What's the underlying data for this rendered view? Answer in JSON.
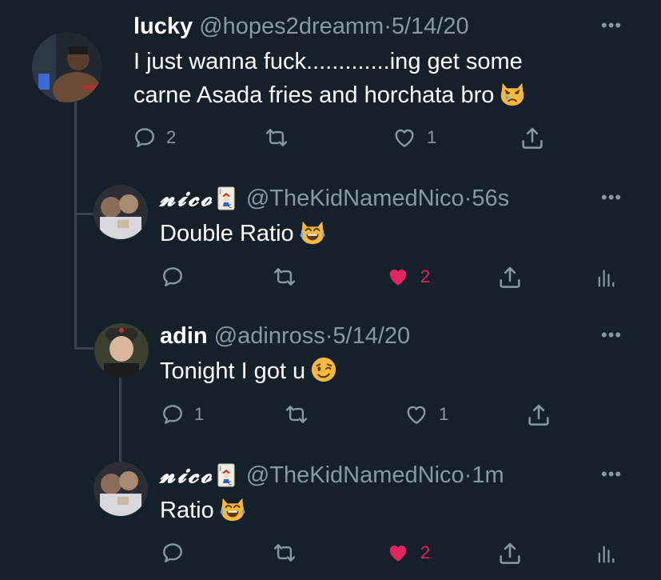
{
  "colors": {
    "background": "#15202b",
    "text": "#ffffff",
    "secondary": "#8899a6",
    "like": "#e0245e",
    "thread_line": "#38444d"
  },
  "tweets": [
    {
      "name": "lucky",
      "handle": "@hopes2dreamm",
      "separator": "·",
      "time": "5/14/20",
      "text_lines": [
        "I just wanna fuck.............ing get some",
        "carne Asada fries and horchata bro"
      ],
      "emoji": "crying-cat-face",
      "actions": {
        "reply": "2",
        "retweet": "",
        "like": "1",
        "liked": false,
        "share": "",
        "analytics": false
      }
    },
    {
      "name": "𝓷𝓲𝓬𝓸",
      "name_emoji": "joker-card",
      "handle": "@TheKidNamedNico",
      "separator": "·",
      "time": "56s",
      "text_lines": [
        "Double Ratio"
      ],
      "emoji": "cat-face-with-tears-of-joy",
      "actions": {
        "reply": "",
        "retweet": "",
        "like": "2",
        "liked": true,
        "share": "",
        "analytics": true
      }
    },
    {
      "name": "adin",
      "handle": "@adinross",
      "separator": "·",
      "time": "5/14/20",
      "text_lines": [
        "Tonight I got u"
      ],
      "emoji": "winking-face",
      "actions": {
        "reply": "1",
        "retweet": "",
        "like": "1",
        "liked": false,
        "share": "",
        "analytics": false
      }
    },
    {
      "name": "𝓷𝓲𝓬𝓸",
      "name_emoji": "joker-card",
      "handle": "@TheKidNamedNico",
      "separator": "·",
      "time": "1m",
      "text_lines": [
        "Ratio"
      ],
      "emoji": "cat-face-with-tears-of-joy",
      "actions": {
        "reply": "",
        "retweet": "",
        "like": "2",
        "liked": true,
        "share": "",
        "analytics": true
      }
    }
  ],
  "more_label": "•••"
}
